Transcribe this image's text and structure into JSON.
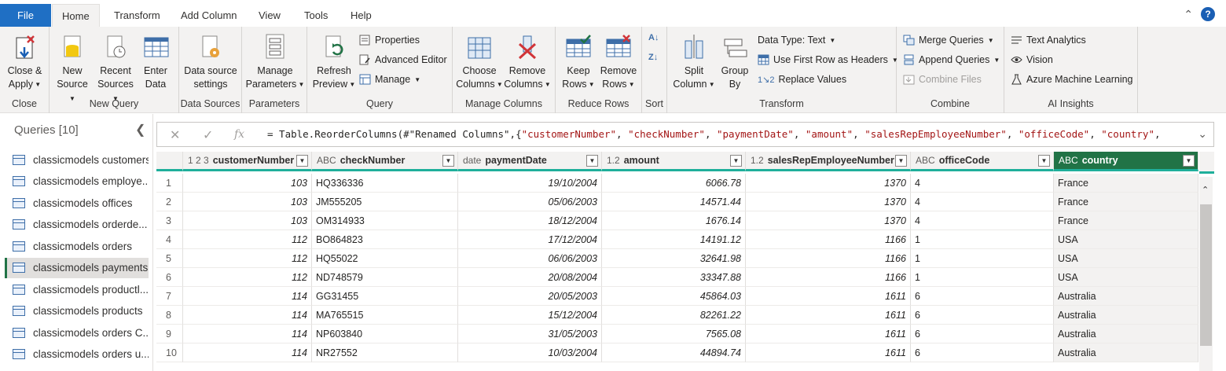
{
  "tabs": [
    "File",
    "Home",
    "Transform",
    "Add Column",
    "View",
    "Tools",
    "Help"
  ],
  "ribbon": {
    "close_group": {
      "label": "Close",
      "close_apply": [
        "Close &",
        "Apply"
      ]
    },
    "new_query": {
      "label": "New Query",
      "new_source": [
        "New",
        "Source"
      ],
      "recent_sources": [
        "Recent",
        "Sources"
      ],
      "enter_data": [
        "Enter",
        "Data"
      ]
    },
    "data_sources": {
      "label": "Data Sources",
      "settings": [
        "Data source",
        "settings"
      ]
    },
    "parameters": {
      "label": "Parameters",
      "manage": [
        "Manage",
        "Parameters"
      ]
    },
    "query": {
      "label": "Query",
      "refresh": [
        "Refresh",
        "Preview"
      ],
      "properties": "Properties",
      "advanced_editor": "Advanced Editor",
      "manage": "Manage"
    },
    "manage_columns": {
      "label": "Manage Columns",
      "choose": [
        "Choose",
        "Columns"
      ],
      "remove": [
        "Remove",
        "Columns"
      ]
    },
    "reduce_rows": {
      "label": "Reduce Rows",
      "keep": [
        "Keep",
        "Rows"
      ],
      "remove": [
        "Remove",
        "Rows"
      ]
    },
    "sort": {
      "label": "Sort"
    },
    "transform": {
      "label": "Transform",
      "split": [
        "Split",
        "Column"
      ],
      "group": [
        "Group",
        "By"
      ],
      "data_type": "Data Type: Text",
      "first_row": "Use First Row as Headers",
      "replace": "Replace Values"
    },
    "combine": {
      "label": "Combine",
      "merge": "Merge Queries",
      "append": "Append Queries",
      "combine_files": "Combine Files"
    },
    "ai": {
      "label": "AI Insights",
      "text_analytics": "Text Analytics",
      "vision": "Vision",
      "azure_ml": "Azure Machine Learning"
    }
  },
  "queries": {
    "header": "Queries [10]",
    "items": [
      "classicmodels customers",
      "classicmodels employe...",
      "classicmodels offices",
      "classicmodels orderde...",
      "classicmodels orders",
      "classicmodels payments",
      "classicmodels productl...",
      "classicmodels products",
      "classicmodels orders C...",
      "classicmodels orders u..."
    ],
    "selected_index": 5
  },
  "formula": {
    "prefix": "= Table.ReorderColumns(#\"Renamed Columns\",{",
    "parts": [
      "\"customerNumber\"",
      ", ",
      "\"checkNumber\"",
      ", ",
      "\"paymentDate\"",
      ", ",
      "\"amount\"",
      ", ",
      "\"salesRepEmployeeNumber\"",
      ", ",
      "\"officeCode\"",
      ", ",
      "\"country\"",
      ","
    ]
  },
  "columns": [
    {
      "type": "1 2 3",
      "name": "customerNumber"
    },
    {
      "type": "ABC",
      "name": "checkNumber"
    },
    {
      "type": "date",
      "name": "paymentDate"
    },
    {
      "type": "1.2",
      "name": "amount"
    },
    {
      "type": "1.2",
      "name": "salesRepEmployeeNumber"
    },
    {
      "type": "ABC",
      "name": "officeCode"
    },
    {
      "type": "ABC",
      "name": "country"
    }
  ],
  "rows": [
    [
      "1",
      "103",
      "HQ336336",
      "19/10/2004",
      "6066.78",
      "1370",
      "4",
      "France"
    ],
    [
      "2",
      "103",
      "JM555205",
      "05/06/2003",
      "14571.44",
      "1370",
      "4",
      "France"
    ],
    [
      "3",
      "103",
      "OM314933",
      "18/12/2004",
      "1676.14",
      "1370",
      "4",
      "France"
    ],
    [
      "4",
      "112",
      "BO864823",
      "17/12/2004",
      "14191.12",
      "1166",
      "1",
      "USA"
    ],
    [
      "5",
      "112",
      "HQ55022",
      "06/06/2003",
      "32641.98",
      "1166",
      "1",
      "USA"
    ],
    [
      "6",
      "112",
      "ND748579",
      "20/08/2004",
      "33347.88",
      "1166",
      "1",
      "USA"
    ],
    [
      "7",
      "114",
      "GG31455",
      "20/05/2003",
      "45864.03",
      "1611",
      "6",
      "Australia"
    ],
    [
      "8",
      "114",
      "MA765515",
      "15/12/2004",
      "82261.22",
      "1611",
      "6",
      "Australia"
    ],
    [
      "9",
      "114",
      "NP603840",
      "31/05/2003",
      "7565.08",
      "1611",
      "6",
      "Australia"
    ],
    [
      "10",
      "114",
      "NR27552",
      "10/03/2004",
      "44894.74",
      "1611",
      "6",
      "Australia"
    ]
  ],
  "colors": {
    "accent": "#217346",
    "file_tab": "#1f6fc4",
    "header_rule": "#1faf9b"
  }
}
